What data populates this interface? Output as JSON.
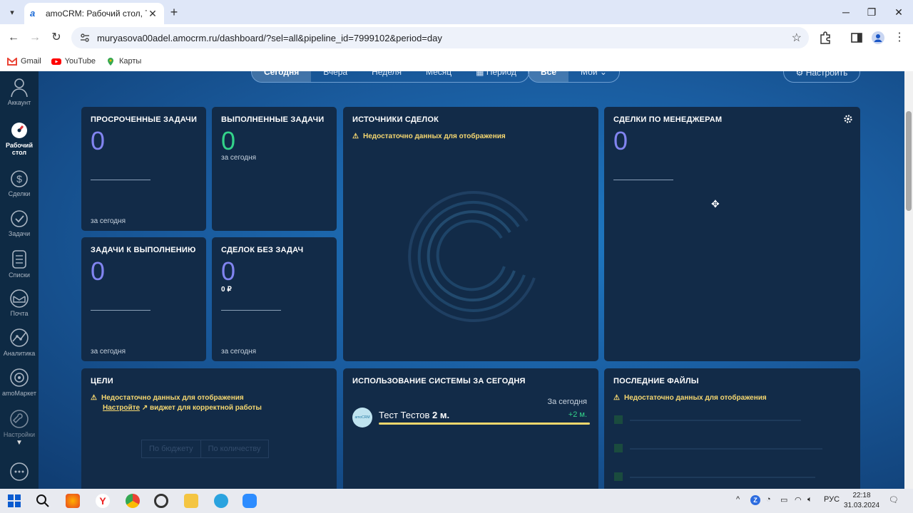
{
  "browser": {
    "tab_title": "amoCRM: Рабочий стол, Тесто",
    "new_tab": "+",
    "url": "muryasova00adel.amocrm.ru/dashboard/?sel=all&pipeline_id=7999102&period=day",
    "bookmarks": [
      {
        "label": "Gmail",
        "icon": "gmail-icon",
        "color": "#ea4335"
      },
      {
        "label": "YouTube",
        "icon": "youtube-icon",
        "color": "#ff0000"
      },
      {
        "label": "Карты",
        "icon": "maps-icon",
        "color": "#34a853"
      }
    ]
  },
  "sidebar": {
    "items": [
      {
        "label": "Аккаунт",
        "icon": "account-icon"
      },
      {
        "label": "Рабочий стол",
        "icon": "dashboard-icon",
        "active": true
      },
      {
        "label": "Сделки",
        "icon": "deals-icon"
      },
      {
        "label": "Задачи",
        "icon": "tasks-icon"
      },
      {
        "label": "Списки",
        "icon": "lists-icon"
      },
      {
        "label": "Почта",
        "icon": "mail-icon"
      },
      {
        "label": "Аналитика",
        "icon": "analytics-icon"
      },
      {
        "label": "amoМаркет",
        "icon": "market-icon"
      },
      {
        "label": "Настройки",
        "icon": "settings-icon"
      }
    ]
  },
  "filters": {
    "period": [
      "Сегодня",
      "Вчера",
      "Неделя",
      "Месяц",
      "Период"
    ],
    "scope": [
      "Все",
      "Мои"
    ],
    "setup": "Настроить"
  },
  "cards": {
    "overdue": {
      "title": "ПРОСРОЧЕННЫЕ ЗАДАЧИ",
      "value": "0",
      "foot": "за сегодня"
    },
    "done": {
      "title": "ВЫПОЛНЕННЫЕ ЗАДАЧИ",
      "value": "0",
      "sub": "за сегодня"
    },
    "sources": {
      "title": "ИСТОЧНИКИ СДЕЛОК",
      "warning": "Недостаточно данных для отображения"
    },
    "managers": {
      "title": "СДЕЛКИ ПО МЕНЕДЖЕРАМ",
      "value": "0"
    },
    "todo": {
      "title": "ЗАДАЧИ К ВЫПОЛНЕНИЮ",
      "value": "0",
      "foot": "за сегодня"
    },
    "no_tasks": {
      "title": "СДЕЛОК БЕЗ ЗАДАЧ",
      "value": "0",
      "amount": "0 ₽",
      "foot": "за сегодня"
    },
    "goals": {
      "title": "ЦЕЛИ",
      "warning": "Недостаточно данных для отображения",
      "link": "Настройте",
      "link_suffix": "виджет для корректной работы",
      "tab1": "По бюджету",
      "tab2": "По количеству"
    },
    "usage": {
      "title": "ИСПОЛЬЗОВАНИЕ СИСТЕМЫ ЗА СЕГОДНЯ",
      "period": "За сегодня",
      "user_name": "Тест Тестов",
      "user_time": "2 м.",
      "delta": "+2 м.",
      "avatar_label": "amoCRM"
    },
    "files": {
      "title": "ПОСЛЕДНИЕ ФАЙЛЫ",
      "warning": "Недостаточно данных для отображения"
    }
  },
  "taskbar": {
    "lang": "РУС",
    "time": "22:18",
    "date": "31.03.2024"
  }
}
